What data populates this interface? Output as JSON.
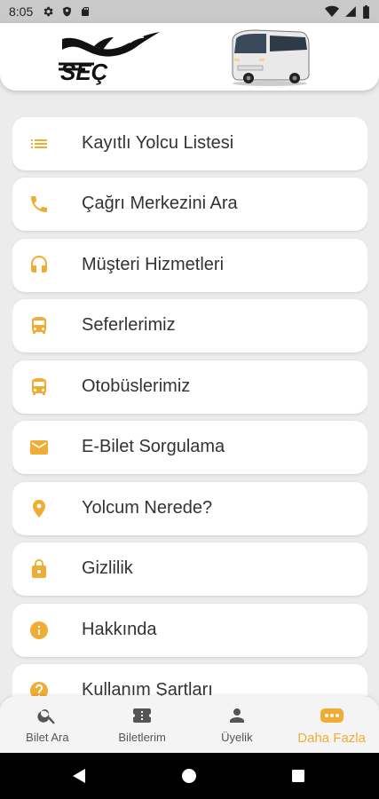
{
  "status_bar": {
    "time": "8:05"
  },
  "header": {
    "logo_text": "SEÇ"
  },
  "menu": {
    "items": [
      {
        "label": "Kayıtlı Yolcu Listesi",
        "icon": "list-icon"
      },
      {
        "label": "Çağrı Merkezini Ara",
        "icon": "phone-icon"
      },
      {
        "label": "Müşteri Hizmetleri",
        "icon": "headset-icon"
      },
      {
        "label": "Seferlerimiz",
        "icon": "bus-icon"
      },
      {
        "label": "Otobüslerimiz",
        "icon": "bus-icon"
      },
      {
        "label": "E-Bilet Sorgulama",
        "icon": "mail-icon"
      },
      {
        "label": "Yolcum Nerede?",
        "icon": "location-pin-icon"
      },
      {
        "label": "Gizlilik",
        "icon": "lock-icon"
      },
      {
        "label": "Hakkında",
        "icon": "info-icon"
      },
      {
        "label": "Kullanım Şartları",
        "icon": "help-icon"
      }
    ]
  },
  "bottom_nav": {
    "tabs": [
      {
        "label": "Bilet Ara",
        "icon": "search-icon"
      },
      {
        "label": "Biletlerim",
        "icon": "ticket-icon"
      },
      {
        "label": "Üyelik",
        "icon": "person-icon"
      },
      {
        "label": "Daha Fazla",
        "icon": "more-icon"
      }
    ],
    "active": "Daha Fazla"
  },
  "colors": {
    "accent": "#f0ad33",
    "background": "#ececec",
    "text": "#333333"
  }
}
